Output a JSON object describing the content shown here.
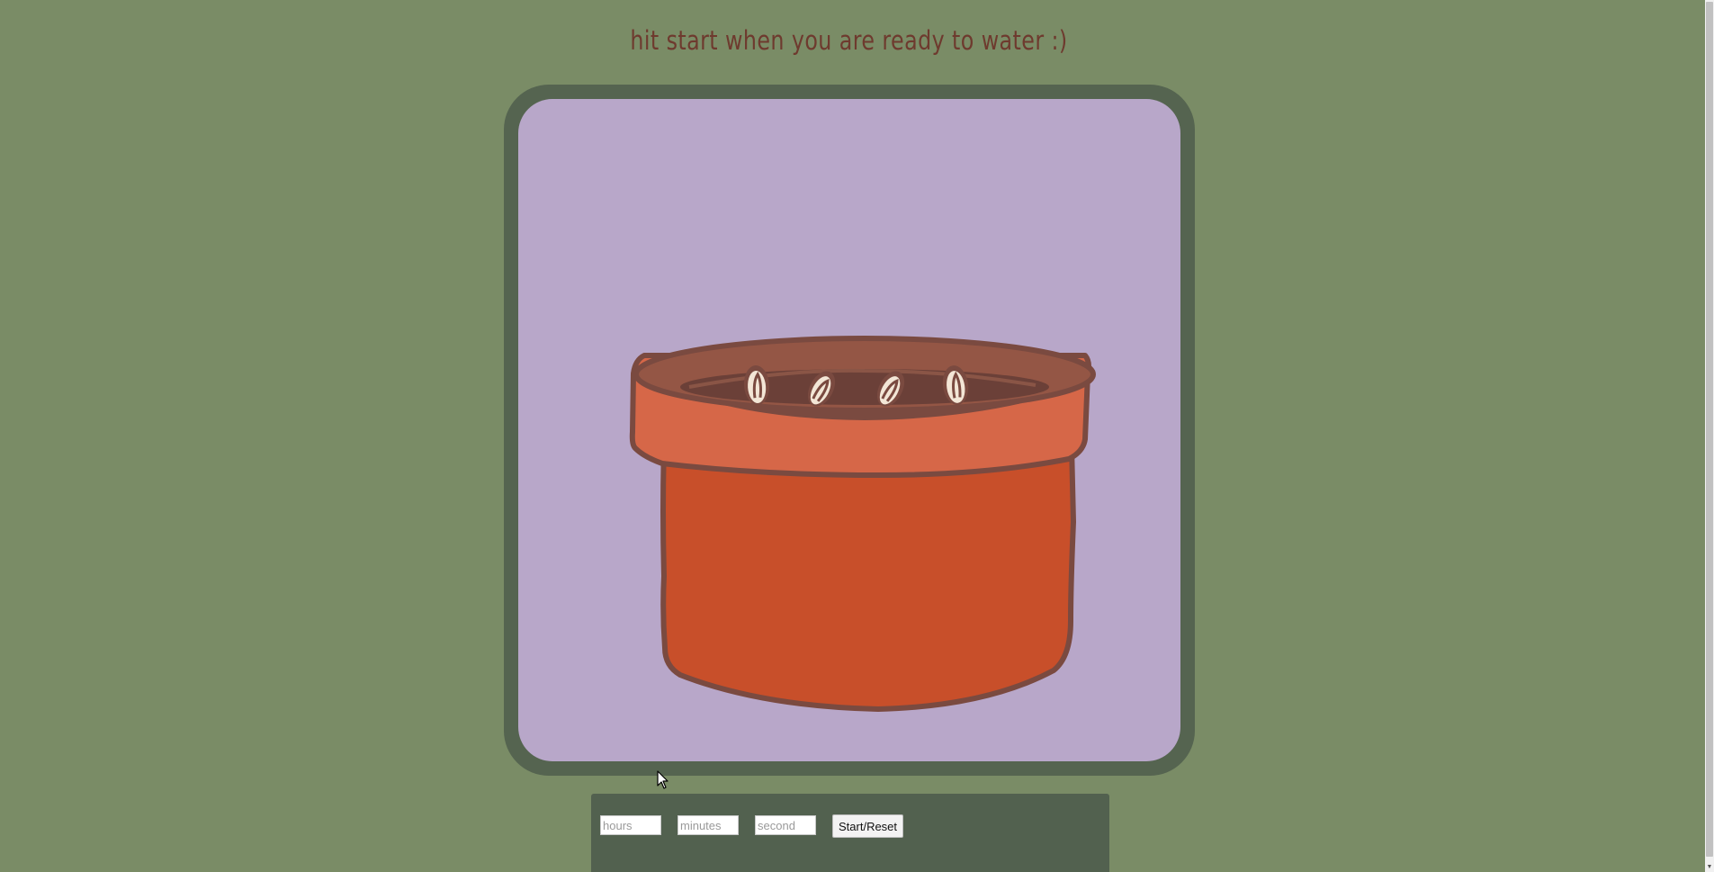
{
  "page": {
    "title": "hit start when you are ready to water :)"
  },
  "illustration": {
    "name": "flower-pot-with-seeds",
    "seed_count": 4,
    "colors": {
      "canvas": "#b8a7c9",
      "frame": "#556450",
      "pot_body": "#c84f2a",
      "pot_rim": "#d66748",
      "soil": "#8a5546",
      "outline": "#7a4a40",
      "seed": "#f3e6d6"
    }
  },
  "timer": {
    "hours_placeholder": "hours",
    "minutes_placeholder": "minutes",
    "seconds_placeholder": "second",
    "start_reset_label": "Start/Reset"
  },
  "colors": {
    "background": "#7a8c66",
    "title_text": "#6e3a2e",
    "controls_panel": "#52614f"
  }
}
